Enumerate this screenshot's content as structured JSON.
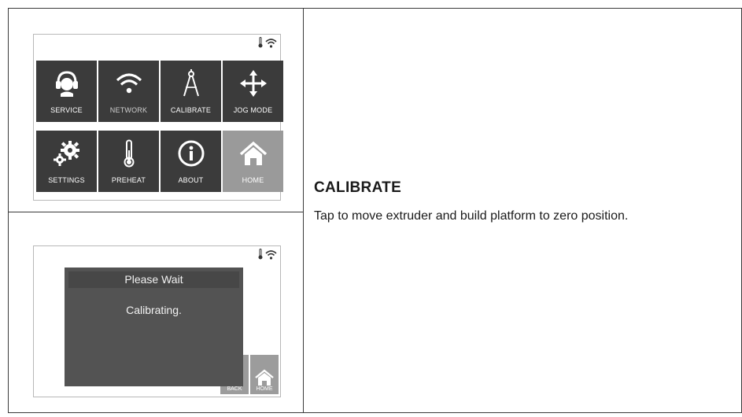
{
  "menu_screen": {
    "tiles": [
      {
        "label": "SERVICE",
        "icon": "headset-icon"
      },
      {
        "label": "NETWORK",
        "icon": "wifi-icon"
      },
      {
        "label": "CALIBRATE",
        "icon": "compass-icon"
      },
      {
        "label": "JOG MODE",
        "icon": "move-arrows-icon"
      },
      {
        "label": "SETTINGS",
        "icon": "gears-icon"
      },
      {
        "label": "PREHEAT",
        "icon": "thermometer-icon"
      },
      {
        "label": "ABOUT",
        "icon": "info-icon"
      },
      {
        "label": "HOME",
        "icon": "home-icon"
      }
    ]
  },
  "calibrate_screen": {
    "dialog_title": "Please Wait",
    "dialog_message": "Calibrating.",
    "back_label": "BACK",
    "home_label": "HOME"
  },
  "section": {
    "heading": "CALIBRATE",
    "description": "Tap to move extruder and build platform to zero position."
  },
  "colors": {
    "tile": "#3b3b3b",
    "tile_active": "#9a9a9a",
    "dialog": "#535353"
  }
}
